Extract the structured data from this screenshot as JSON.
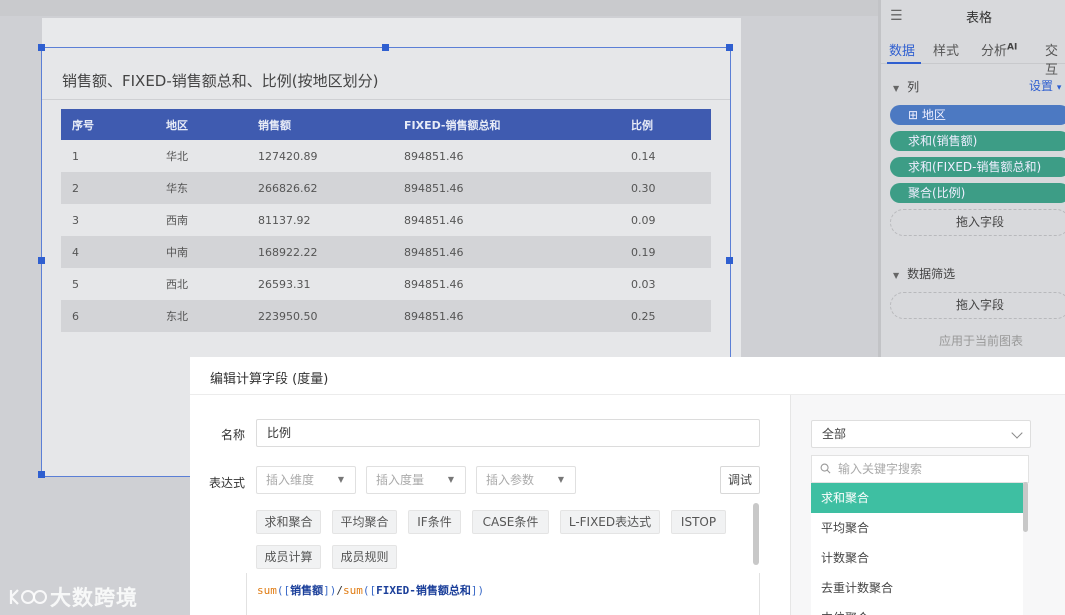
{
  "chart": {
    "title": "销售额、FIXED-销售额总和、比例(按地区划分)",
    "columns": [
      "序号",
      "地区",
      "销售额",
      "FIXED-销售额总和",
      "比例"
    ],
    "rows": [
      [
        "1",
        "华北",
        "127420.89",
        "894851.46",
        "0.14"
      ],
      [
        "2",
        "华东",
        "266826.62",
        "894851.46",
        "0.30"
      ],
      [
        "3",
        "西南",
        "81137.92",
        "894851.46",
        "0.09"
      ],
      [
        "4",
        "中南",
        "168922.22",
        "894851.46",
        "0.19"
      ],
      [
        "5",
        "西北",
        "26593.31",
        "894851.46",
        "0.03"
      ],
      [
        "6",
        "东北",
        "223950.50",
        "894851.46",
        "0.25"
      ]
    ]
  },
  "panel": {
    "title": "表格",
    "tabs": [
      "数据",
      "样式",
      "分析",
      "交互"
    ],
    "ai_badge": "AI",
    "columns_section": "列",
    "settings": "设置",
    "fields": [
      "⊞ 地区",
      "求和(销售额)",
      "求和(FIXED-销售额总和)",
      "聚合(比例)"
    ],
    "drop_field": "拖入字段",
    "filter_section": "数据筛选",
    "drop_field2": "拖入字段",
    "apply_current": "应用于当前图表"
  },
  "dialog": {
    "title": "编辑计算字段 (度量)",
    "name_label": "名称",
    "name_value": "比例",
    "expr_label": "表达式",
    "insert_dimension": "插入维度",
    "insert_measure": "插入度量",
    "insert_param": "插入参数",
    "debug": "调试",
    "functions": [
      "求和聚合",
      "平均聚合",
      "IF条件",
      "CASE条件",
      "L-FIXED表达式",
      "ISTOP",
      "成员计算",
      "成员规则"
    ],
    "expression": {
      "fn1": "sum",
      "field1": "销售额",
      "op": "/",
      "fn2": "sum",
      "field2": "FIXED-销售额总和"
    },
    "filter_all": "全部",
    "search_placeholder": "输入关键字搜索",
    "fn_list": [
      "求和聚合",
      "平均聚合",
      "计数聚合",
      "去重计数聚合",
      "中位聚合"
    ]
  },
  "watermark": "大数跨境",
  "colors": {
    "primary_blue": "#2f5fd0",
    "header_blue": "#3f5bb0",
    "measure_green": "#3d9d86",
    "active_teal": "#3ebfa2"
  }
}
